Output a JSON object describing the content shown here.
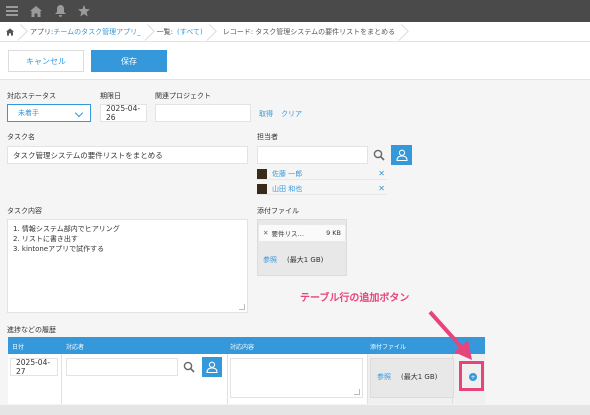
{
  "breadcrumb": {
    "app_prefix": "アプリ: ",
    "app_name": "チームのタスク管理アプリ_",
    "list_prefix": "一覧: ",
    "list_name": "(すべて)",
    "record": "レコード: タスク管理システムの要件リストをまとめる"
  },
  "toolbar": {
    "cancel_label": "キャンセル",
    "save_label": "保存"
  },
  "fields": {
    "status": {
      "label": "対応ステータス",
      "value": "未着手"
    },
    "due_date": {
      "label": "期限日",
      "value": "2025-04-26"
    },
    "related_project": {
      "label": "関連プロジェクト",
      "value": "",
      "fetch_label": "取得",
      "clear_label": "クリア"
    },
    "task_name": {
      "label": "タスク名",
      "value": "タスク管理システムの要件リストをまとめる"
    },
    "assignee": {
      "label": "担当者",
      "users": [
        "佐藤 一郎",
        "山田 和也"
      ]
    },
    "task_content": {
      "label": "タスク内容",
      "lines": [
        "1.  情報システム部内でヒアリング",
        "2.  リストに書き出す",
        "3.  kintoneアプリで試作する"
      ]
    },
    "attachment": {
      "label": "添付ファイル",
      "file_name": "要件リス…",
      "file_size": "9 KB",
      "browse_label": "参照",
      "max_note": "(最大1 GB)"
    }
  },
  "history": {
    "label": "進捗などの履歴",
    "columns": [
      "日付",
      "対応者",
      "対応内容",
      "添付ファイル"
    ],
    "row": {
      "date": "2025-04-27",
      "browse_label": "参照",
      "max_note": "(最大1 GB)",
      "add_symbol": "+"
    }
  },
  "annotation": {
    "text": "テーブル行の追加ボタン"
  },
  "colors": {
    "accent": "#3498db",
    "annotation": "#e8447b",
    "topbar": "#4a4a4a"
  }
}
